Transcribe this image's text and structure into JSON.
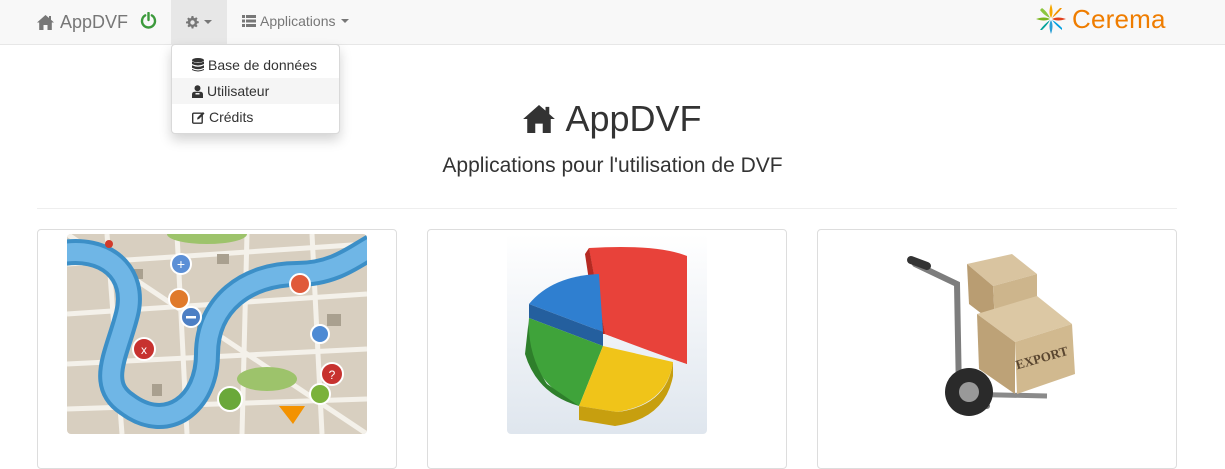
{
  "navbar": {
    "brand": "AppDVF",
    "applications_label": "Applications",
    "logo_text": "Cerema"
  },
  "dropdown": {
    "items": [
      {
        "label": "Base de données",
        "icon": "database-icon"
      },
      {
        "label": "Utilisateur",
        "icon": "user-icon"
      },
      {
        "label": "Crédits",
        "icon": "edit-icon"
      }
    ]
  },
  "hero": {
    "title": "AppDVF",
    "subtitle": "Applications pour l'utilisation de DVF"
  },
  "cards": [
    {
      "image": "map-thumbnail"
    },
    {
      "image": "pie-chart-thumbnail"
    },
    {
      "image": "export-hand-truck-thumbnail",
      "box_text": "EXPORT"
    }
  ],
  "colors": {
    "logo_orange": "#ef7d00",
    "power_green": "#3c9a3c",
    "navbar_bg": "#f8f8f8"
  }
}
